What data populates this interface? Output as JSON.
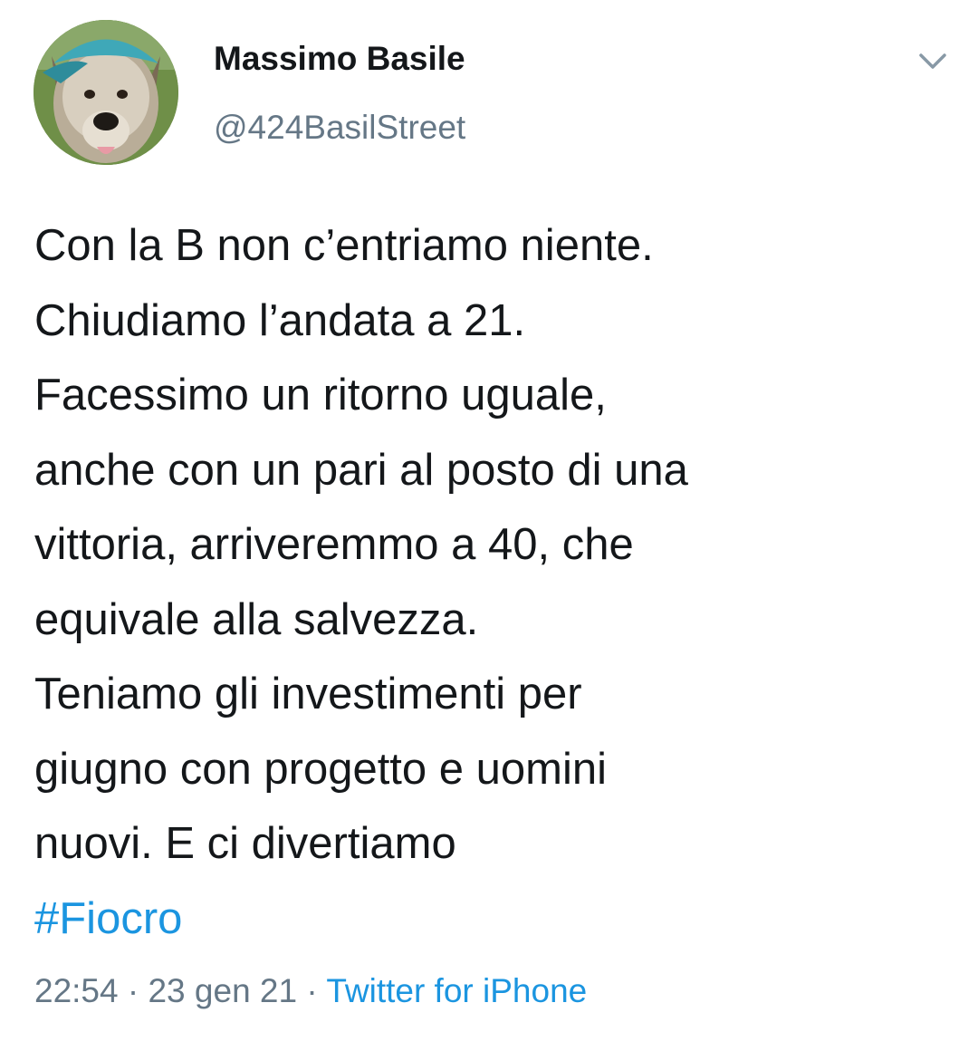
{
  "user": {
    "display_name": "Massimo Basile",
    "handle": "@424BasilStreet"
  },
  "tweet": {
    "lines": [
      "Con la B non c’entriamo niente.",
      "Chiudiamo l’andata a 21.",
      "Facessimo un ritorno uguale,",
      "anche con un pari al posto di una",
      "vittoria, arriveremmo a 40, che",
      "equivale alla salvezza.",
      "Teniamo gli investimenti per",
      "giugno con progetto e uomini",
      "nuovi. E ci divertiamo"
    ],
    "hashtag": "#Fiocro"
  },
  "meta": {
    "time": "22:54",
    "separator": " · ",
    "date": "23 gen 21",
    "source": "Twitter for iPhone"
  },
  "icons": {
    "menu": "chevron-down-icon",
    "avatar": "dog-avatar"
  },
  "colors": {
    "text": "#14171a",
    "secondary": "#657786",
    "link": "#1b95e0"
  }
}
